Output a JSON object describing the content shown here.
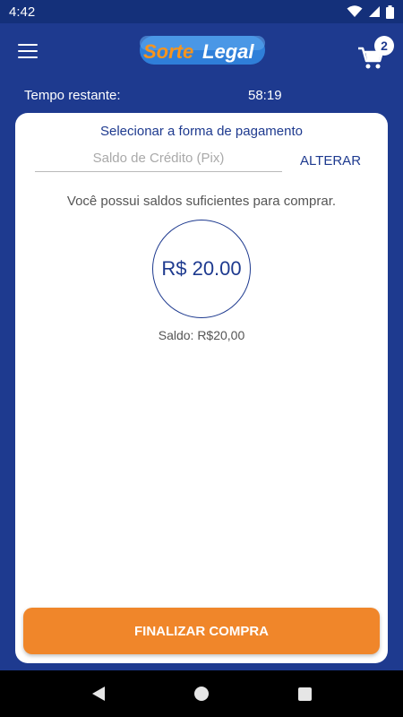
{
  "status_bar": {
    "time": "4:42",
    "icons": [
      "wifi-icon",
      "signal-icon",
      "battery-icon"
    ]
  },
  "header": {
    "menu_icon": "menu-icon",
    "logo_text_part1": "Sorte",
    "logo_text_part2": "Legal",
    "cart_icon": "cart-icon",
    "cart_count": "2"
  },
  "timer": {
    "label": "Tempo restante:",
    "value": "58:19"
  },
  "payment": {
    "title": "Selecionar a forma de pagamento",
    "method_placeholder": "Saldo de Crédito (Pix)",
    "change_label": "ALTERAR",
    "message": "Você possui saldos suficientes para comprar.",
    "amount": "R$ 20.00",
    "balance": "Saldo: R$20,00",
    "finish_label": "FINALIZAR COMPRA"
  },
  "colors": {
    "primary": "#1e3a8f",
    "accent": "#f0862a",
    "card": "#ffffff"
  }
}
